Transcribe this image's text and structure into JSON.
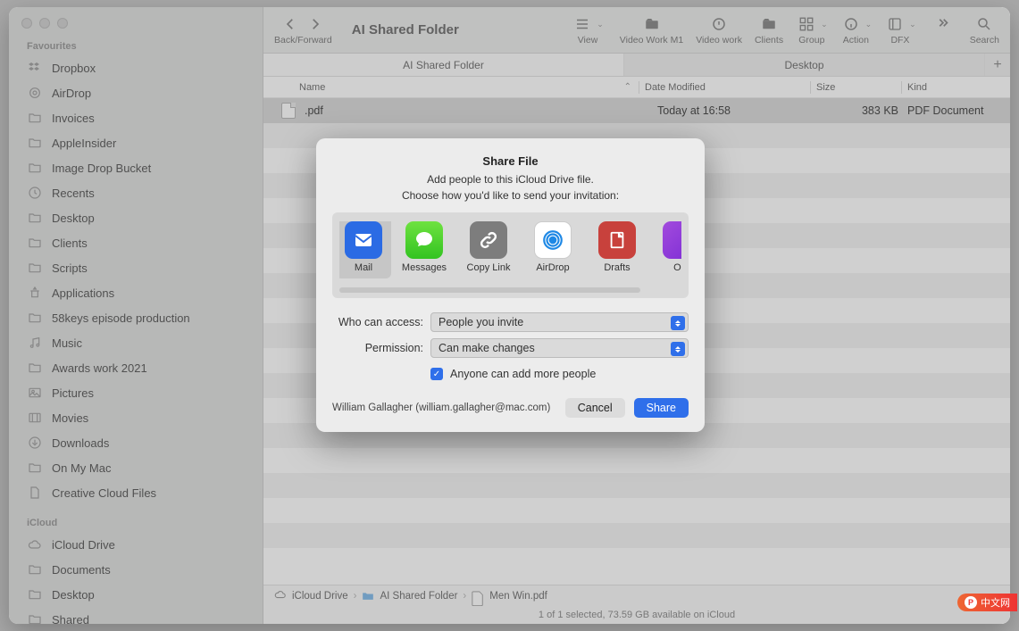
{
  "window": {
    "title": "AI Shared Folder"
  },
  "toolbar": {
    "backforward": "Back/Forward",
    "view": "View",
    "groups": [
      {
        "label": "Video Work M1"
      },
      {
        "label": "Video work"
      },
      {
        "label": "Clients"
      },
      {
        "label": "Group"
      },
      {
        "label": "Action"
      },
      {
        "label": "DFX"
      }
    ],
    "search": "Search"
  },
  "tabs": {
    "active": "AI Shared Folder",
    "inactive": "Desktop"
  },
  "columns": {
    "name": "Name",
    "date": "Date Modified",
    "size": "Size",
    "kind": "Kind"
  },
  "rows": [
    {
      "name": ".pdf",
      "date": "Today at 16:58",
      "size": "383 KB",
      "kind": "PDF Document"
    }
  ],
  "sidebar": {
    "sections": [
      {
        "title": "Favourites",
        "items": [
          {
            "label": "Dropbox",
            "icon": "dropbox"
          },
          {
            "label": "AirDrop",
            "icon": "airdrop"
          },
          {
            "label": "Invoices",
            "icon": "folder"
          },
          {
            "label": "AppleInsider",
            "icon": "folder"
          },
          {
            "label": "Image Drop Bucket",
            "icon": "folder"
          },
          {
            "label": "Recents",
            "icon": "clock"
          },
          {
            "label": "Desktop",
            "icon": "folder"
          },
          {
            "label": "Clients",
            "icon": "folder"
          },
          {
            "label": "Scripts",
            "icon": "folder"
          },
          {
            "label": "Applications",
            "icon": "apps"
          },
          {
            "label": "58keys episode production",
            "icon": "folder"
          },
          {
            "label": "Music",
            "icon": "music"
          },
          {
            "label": "Awards work 2021",
            "icon": "folder"
          },
          {
            "label": "Pictures",
            "icon": "pictures"
          },
          {
            "label": "Movies",
            "icon": "movies"
          },
          {
            "label": "Downloads",
            "icon": "downloads"
          },
          {
            "label": "On My Mac",
            "icon": "folder"
          },
          {
            "label": "Creative Cloud Files",
            "icon": "doc"
          }
        ]
      },
      {
        "title": "iCloud",
        "items": [
          {
            "label": "iCloud Drive",
            "icon": "cloud"
          },
          {
            "label": "Documents",
            "icon": "folder"
          },
          {
            "label": "Desktop",
            "icon": "folder"
          },
          {
            "label": "Shared",
            "icon": "folder"
          }
        ]
      }
    ]
  },
  "pathbar": {
    "items": [
      "iCloud Drive",
      "AI Shared Folder",
      "Men Win.pdf"
    ]
  },
  "statusbar": "1 of 1 selected, 73.59 GB available on iCloud",
  "dialog": {
    "title": "Share File",
    "line1": "Add people to this iCloud Drive file.",
    "line2": "Choose how you'd like to send your invitation:",
    "apps": [
      {
        "label": "Mail"
      },
      {
        "label": "Messages"
      },
      {
        "label": "Copy Link"
      },
      {
        "label": "AirDrop"
      },
      {
        "label": "Drafts"
      },
      {
        "label": "Om"
      }
    ],
    "access_label": "Who can access:",
    "access_value": "People you invite",
    "perm_label": "Permission:",
    "perm_value": "Can make changes",
    "checkbox": "Anyone can add more people",
    "user": "William Gallagher (william.gallagher@mac.com)",
    "cancel": "Cancel",
    "share": "Share"
  },
  "watermark": "中文网"
}
